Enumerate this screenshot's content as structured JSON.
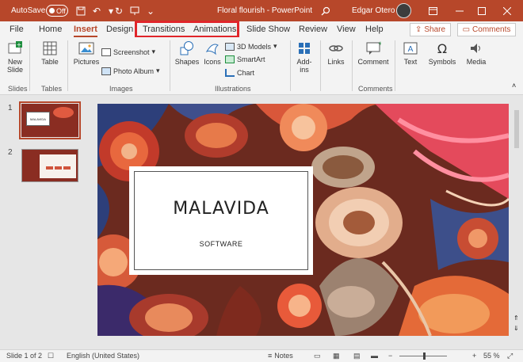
{
  "titlebar": {
    "autosave_label": "AutoSave",
    "autosave_state": "Off",
    "doc_title": "Floral flourish - PowerPoint",
    "user_name": "Edgar Otero",
    "icons": [
      "save-icon",
      "undo-icon",
      "redo-icon",
      "present-icon",
      "customize-icon",
      "search-icon",
      "ribbon-display-icon",
      "minimize-icon",
      "maximize-icon",
      "close-icon"
    ]
  },
  "tabs": [
    {
      "label": "File"
    },
    {
      "label": "Home"
    },
    {
      "label": "Insert"
    },
    {
      "label": "Design"
    },
    {
      "label": "Transitions"
    },
    {
      "label": "Animations"
    },
    {
      "label": "Slide Show"
    },
    {
      "label": "Review"
    },
    {
      "label": "View"
    },
    {
      "label": "Help"
    }
  ],
  "active_tab": "Insert",
  "share_label": "Share",
  "comments_label": "Comments",
  "ribbon": {
    "new_slide": "New Slide",
    "table": "Table",
    "pictures": "Pictures",
    "screenshot": "Screenshot",
    "photo_album": "Photo Album",
    "shapes": "Shapes",
    "icons": "Icons",
    "models_3d": "3D Models",
    "smartart": "SmartArt",
    "chart": "Chart",
    "addins": "Add-ins",
    "links": "Links",
    "comment": "Comment",
    "text": "Text",
    "symbols": "Symbols",
    "media": "Media",
    "groups": {
      "slides": "Slides",
      "tables": "Tables",
      "images": "Images",
      "illustrations": "Illustrations",
      "comments": "Comments"
    }
  },
  "thumbnails": [
    {
      "num": "1",
      "caption": "MALAVIDA"
    },
    {
      "num": "2",
      "caption": ""
    }
  ],
  "slide": {
    "title": "MALAVIDA",
    "subtitle": "SOFTWARE"
  },
  "status": {
    "slide_info": "Slide 1 of 2",
    "language": "English (United States)",
    "notes_label": "Notes",
    "zoom": "55 %",
    "zoom_fraction": 0.55
  },
  "colors": {
    "accent": "#b7472a",
    "highlight": "#e0252a"
  }
}
